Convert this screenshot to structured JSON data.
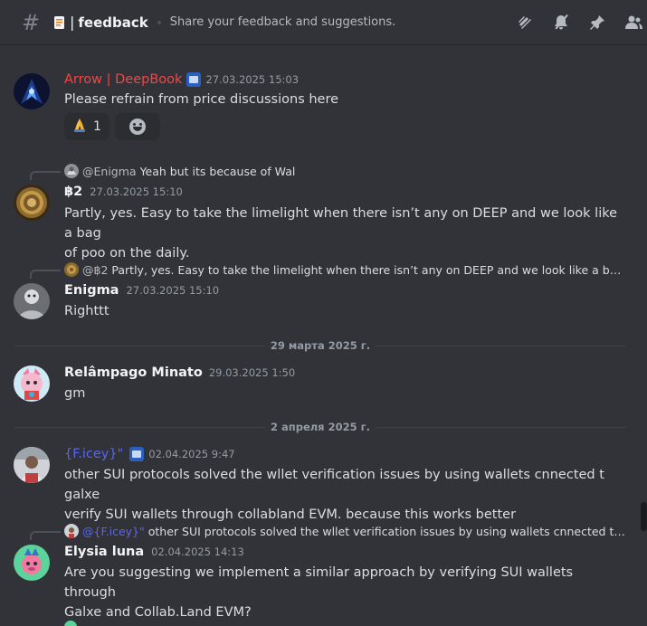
{
  "header": {
    "channel_name": "feedback",
    "topic": "Share your feedback and suggestions.",
    "icons": [
      "threads-icon",
      "mute-icon",
      "pin-icon",
      "members-icon"
    ]
  },
  "partial_top_text": "...",
  "messages": [
    {
      "author": "Arrow | DeepBook",
      "author_color": "#f04747",
      "timestamp": "27.03.2025 15:03",
      "text": "Please refrain from price discussions here",
      "reactions": [
        {
          "emoji": "🙏",
          "count": "1"
        }
      ]
    },
    {
      "reply_to": {
        "name": "@Enigma",
        "text": "Yeah but its because of Wal"
      },
      "author": "฿2",
      "timestamp": "27.03.2025 15:10",
      "text_line1": "Partly, yes. Easy to take the limelight when there isn’t any on DEEP and we look like a bag",
      "text_line2": "of poo on the daily."
    },
    {
      "reply_to": {
        "name": "@฿2",
        "text": "Partly, yes. Easy to take the limelight when there isn’t any on DEEP and we look like a bag of ..."
      },
      "author": "Enigma",
      "timestamp": "27.03.2025 15:10",
      "text": "Righttt"
    },
    {
      "author": "Relâmpago Minato",
      "timestamp": "29.03.2025 1:50",
      "text": "gm"
    },
    {
      "author": "{F.icey}\"",
      "author_color": "#5865f2",
      "timestamp": "02.04.2025 9:47",
      "text_line1": "other SUI protocols solved the wllet verification issues by using wallets cnnected t galxe",
      "text_line2": "verify SUI wallets through collabland EVM. because this works better"
    },
    {
      "reply_to": {
        "name": "@{F.icey}\"",
        "text": "other SUI protocols solved the wllet verification issues by using wallets cnnected t galx..."
      },
      "author": "Elysia luna",
      "timestamp": "02.04.2025 14:13",
      "text_line1": "Are you suggesting we implement a similar approach by verifying SUI wallets through",
      "text_line2": "Galxe and Collab.Land EVM?"
    }
  ],
  "dividers": [
    "29 марта 2025 г.",
    "2 апреля 2025 г."
  ]
}
